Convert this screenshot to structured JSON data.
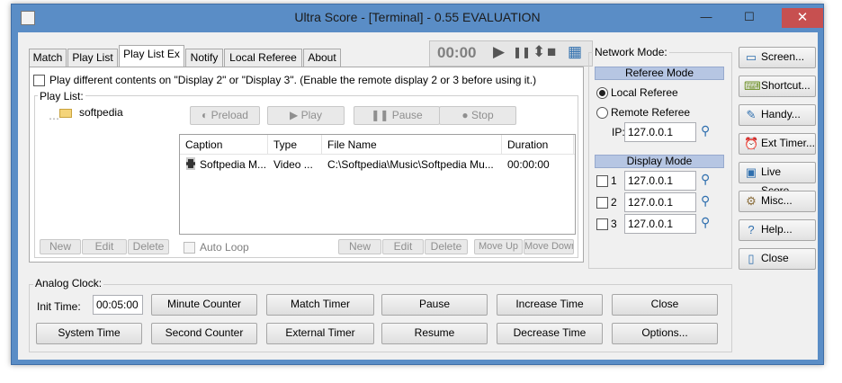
{
  "window": {
    "title": "Ultra Score - [Terminal] - 0.55 EVALUATION",
    "min": "—",
    "max": "☐",
    "close": "✕"
  },
  "tabs": [
    "Match",
    "Play List",
    "Play List Ex",
    "Notify",
    "Local Referee",
    "About"
  ],
  "timer": {
    "display": "00:00",
    "play": "▶",
    "pause": "❚❚",
    "updown": "⬍",
    "stop": "■",
    "grid": "▦"
  },
  "playlist": {
    "option_text": "Play different contents on \"Display 2\" or \"Display 3\". (Enable the remote display 2 or 3 before using it.)",
    "group_label": "Play List:",
    "tree_item": "softpedia",
    "controls": {
      "preload": "Preload",
      "play": "Play",
      "pause": "Pause",
      "stop": "Stop"
    },
    "columns": [
      "Caption",
      "Type",
      "File Name",
      "Duration"
    ],
    "rows": [
      {
        "caption": "Softpedia M...",
        "type": "Video ...",
        "file": "C:\\Softpedia\\Music\\Softpedia Mu...",
        "duration": "00:00:00"
      }
    ],
    "tree_buttons": {
      "new": "New",
      "edit": "Edit",
      "delete": "Delete"
    },
    "auto_loop": "Auto Loop",
    "list_buttons": {
      "new": "New",
      "edit": "Edit",
      "delete": "Delete",
      "move_up": "Move Up",
      "move_down": "Move Down"
    }
  },
  "network": {
    "label": "Network Mode:",
    "referee_mode": "Referee Mode",
    "local_referee": "Local Referee",
    "remote_referee": "Remote Referee",
    "ip_label": "IP:",
    "ip": "127.0.0.1",
    "display_mode": "Display Mode",
    "displays": [
      {
        "n": "1",
        "ip": "127.0.0.1"
      },
      {
        "n": "2",
        "ip": "127.0.0.1"
      },
      {
        "n": "3",
        "ip": "127.0.0.1"
      }
    ]
  },
  "side_buttons": [
    {
      "label": "Screen...",
      "icon": "screen-icon",
      "glyph": "▭"
    },
    {
      "label": "Shortcut...",
      "icon": "shortcut-icon",
      "glyph": "⌨"
    },
    {
      "label": "Handy...",
      "icon": "handy-icon",
      "glyph": "✎"
    },
    {
      "label": "Ext Timer...",
      "icon": "ext-timer-icon",
      "glyph": "⏰"
    },
    {
      "label": "Live Score...",
      "icon": "live-score-icon",
      "glyph": "▣"
    },
    {
      "label": "Misc...",
      "icon": "misc-icon",
      "glyph": "⚙"
    },
    {
      "label": "Help...",
      "icon": "help-icon",
      "glyph": "?"
    },
    {
      "label": "Close",
      "icon": "close-door-icon",
      "glyph": "▯"
    }
  ],
  "clock": {
    "label": "Analog Clock:",
    "init_label": "Init Time:",
    "init_time": "00:05:00",
    "buttons_row1": [
      "Minute Counter",
      "Match Timer",
      "Pause",
      "Increase Time",
      "Close"
    ],
    "buttons_row2": [
      "System Time",
      "Second Counter",
      "External Timer",
      "Resume",
      "Decrease Time",
      "Options..."
    ]
  },
  "colors": {
    "titlebar": "#5a8dc6",
    "close": "#c75050",
    "section": "#b6c6e3"
  }
}
